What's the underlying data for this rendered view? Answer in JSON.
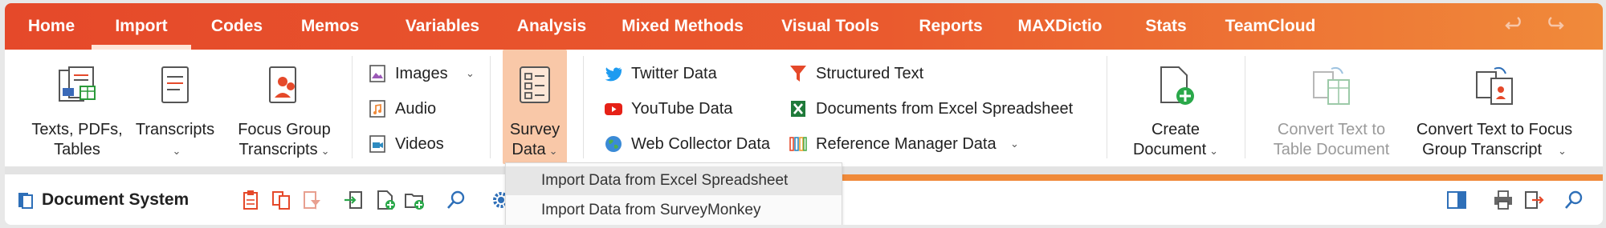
{
  "menu": {
    "tabs": [
      {
        "label": "Home"
      },
      {
        "label": "Import"
      },
      {
        "label": "Codes"
      },
      {
        "label": "Memos"
      },
      {
        "label": "Variables"
      },
      {
        "label": "Analysis"
      },
      {
        "label": "Mixed Methods"
      },
      {
        "label": "Visual Tools"
      },
      {
        "label": "Reports"
      },
      {
        "label": "MAXDictio"
      },
      {
        "label": "Stats"
      },
      {
        "label": "TeamCloud"
      }
    ],
    "active_tab": "Import"
  },
  "ribbon": {
    "texts": {
      "line1": "Texts, PDFs,",
      "line2": "Tables"
    },
    "transcripts": {
      "line1": "Transcripts"
    },
    "focus": {
      "line1": "Focus Group",
      "line2": "Transcripts"
    },
    "images": "Images",
    "audio": "Audio",
    "videos": "Videos",
    "survey": {
      "line1": "Survey",
      "line2": "Data"
    },
    "twitter": "Twitter Data",
    "youtube": "YouTube Data",
    "webcollector": "Web Collector Data",
    "structured": "Structured Text",
    "excel_docs": "Documents from Excel Spreadsheet",
    "refmanager": "Reference Manager Data",
    "create": {
      "line1": "Create",
      "line2": "Document"
    },
    "convert_table": {
      "line1": "Convert Text to",
      "line2": "Table Document"
    },
    "convert_focus": {
      "line1": "Convert Text to Focus",
      "line2": "Group Transcript"
    }
  },
  "docbar": {
    "title": "Document System"
  },
  "dropdown": {
    "items": [
      "Import Data from Excel Spreadsheet",
      "Import Data from SurveyMonkey"
    ]
  },
  "colors": {
    "menubar_start": "#e5492a",
    "menubar_end": "#f08a3a",
    "survey_highlight": "#f9c8a8"
  }
}
